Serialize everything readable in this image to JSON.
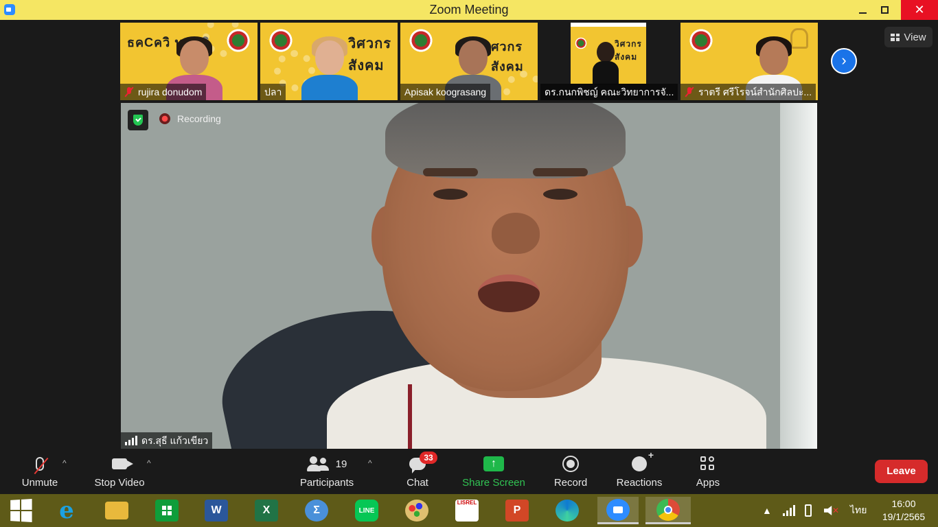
{
  "window": {
    "title": "Zoom Meeting",
    "minimize": "—",
    "close": "✕"
  },
  "view_button": {
    "label": "View"
  },
  "next_page_button": {
    "glyph": "›"
  },
  "thumbnails": [
    {
      "name": "rujira donudom",
      "muted": true,
      "poster": "ธคCควิ นคชธิ"
    },
    {
      "name": "ปลา",
      "muted": false,
      "poster": "วิศวกร สังคม"
    },
    {
      "name": "Apisak koograsang",
      "muted": false,
      "poster": "ศวกร สังคม"
    },
    {
      "name": "ดร.กนกพิชญ์ คณะวิทยาการจั...",
      "muted": false,
      "poster": "วิศวกร สังคม"
    },
    {
      "name": "ราตรี   ศรีโรจน์สำนักศิลปะ...",
      "muted": true,
      "poster": ""
    }
  ],
  "main_video": {
    "recording_label": "Recording",
    "speaker_name": "ดร.สุธี  แก้วเขียว"
  },
  "toolbar": {
    "unmute": "Unmute",
    "stop_video": "Stop Video",
    "participants": "Participants",
    "participants_count": "19",
    "chat": "Chat",
    "chat_badge": "33",
    "share_screen": "Share Screen",
    "share_glyph": "↑",
    "record": "Record",
    "reactions": "Reactions",
    "apps": "Apps",
    "leave": "Leave",
    "caret": "^"
  },
  "taskbar": {
    "apps": [
      {
        "name": "internet-explorer",
        "glyph": "e",
        "color": "#1ba1e2"
      },
      {
        "name": "file-explorer",
        "glyph": "",
        "color": "#e8b93c"
      },
      {
        "name": "store",
        "glyph": "",
        "color": "#0f9d3a"
      },
      {
        "name": "word",
        "glyph": "W",
        "color": "#2b579a"
      },
      {
        "name": "excel",
        "glyph": "X",
        "color": "#217346"
      },
      {
        "name": "math-input",
        "glyph": "Σ",
        "color": "#4a90d9"
      },
      {
        "name": "line",
        "glyph": "LINE",
        "color": "#06c755"
      },
      {
        "name": "paint",
        "glyph": "",
        "color": "#e0c070"
      },
      {
        "name": "lisrel",
        "glyph": "LISREL",
        "color": "#ffffff"
      },
      {
        "name": "powerpoint",
        "glyph": "P",
        "color": "#d24726"
      },
      {
        "name": "edge",
        "glyph": "",
        "color": "#0f7bd0"
      },
      {
        "name": "zoom",
        "glyph": "",
        "color": "#2d8cff"
      },
      {
        "name": "chrome",
        "glyph": "",
        "color": "#dd4b39"
      }
    ],
    "language": "ไทย",
    "tray_caret": "▲",
    "time": "16:00",
    "date": "19/1/2565"
  }
}
